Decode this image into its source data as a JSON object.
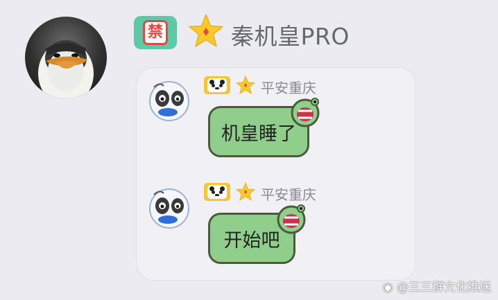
{
  "sender": {
    "name": "秦机皇PRO",
    "ban_badge_glyph": "禁",
    "avatar_icon": "penguin-avatar-icon",
    "accent_color": "#5cc9a7"
  },
  "forwarded_card": {
    "messages": [
      {
        "sender_name": "平安重庆",
        "text": "机皇睡了"
      },
      {
        "sender_name": "平安重庆",
        "text": "开始吧"
      }
    ]
  },
  "watermark": {
    "text": "@三三群文化推送"
  },
  "colors": {
    "bubble_fill": "#8fce8b",
    "bubble_border": "#4b5a3a",
    "star": "#f7c92b",
    "background": "#ebebf1"
  }
}
